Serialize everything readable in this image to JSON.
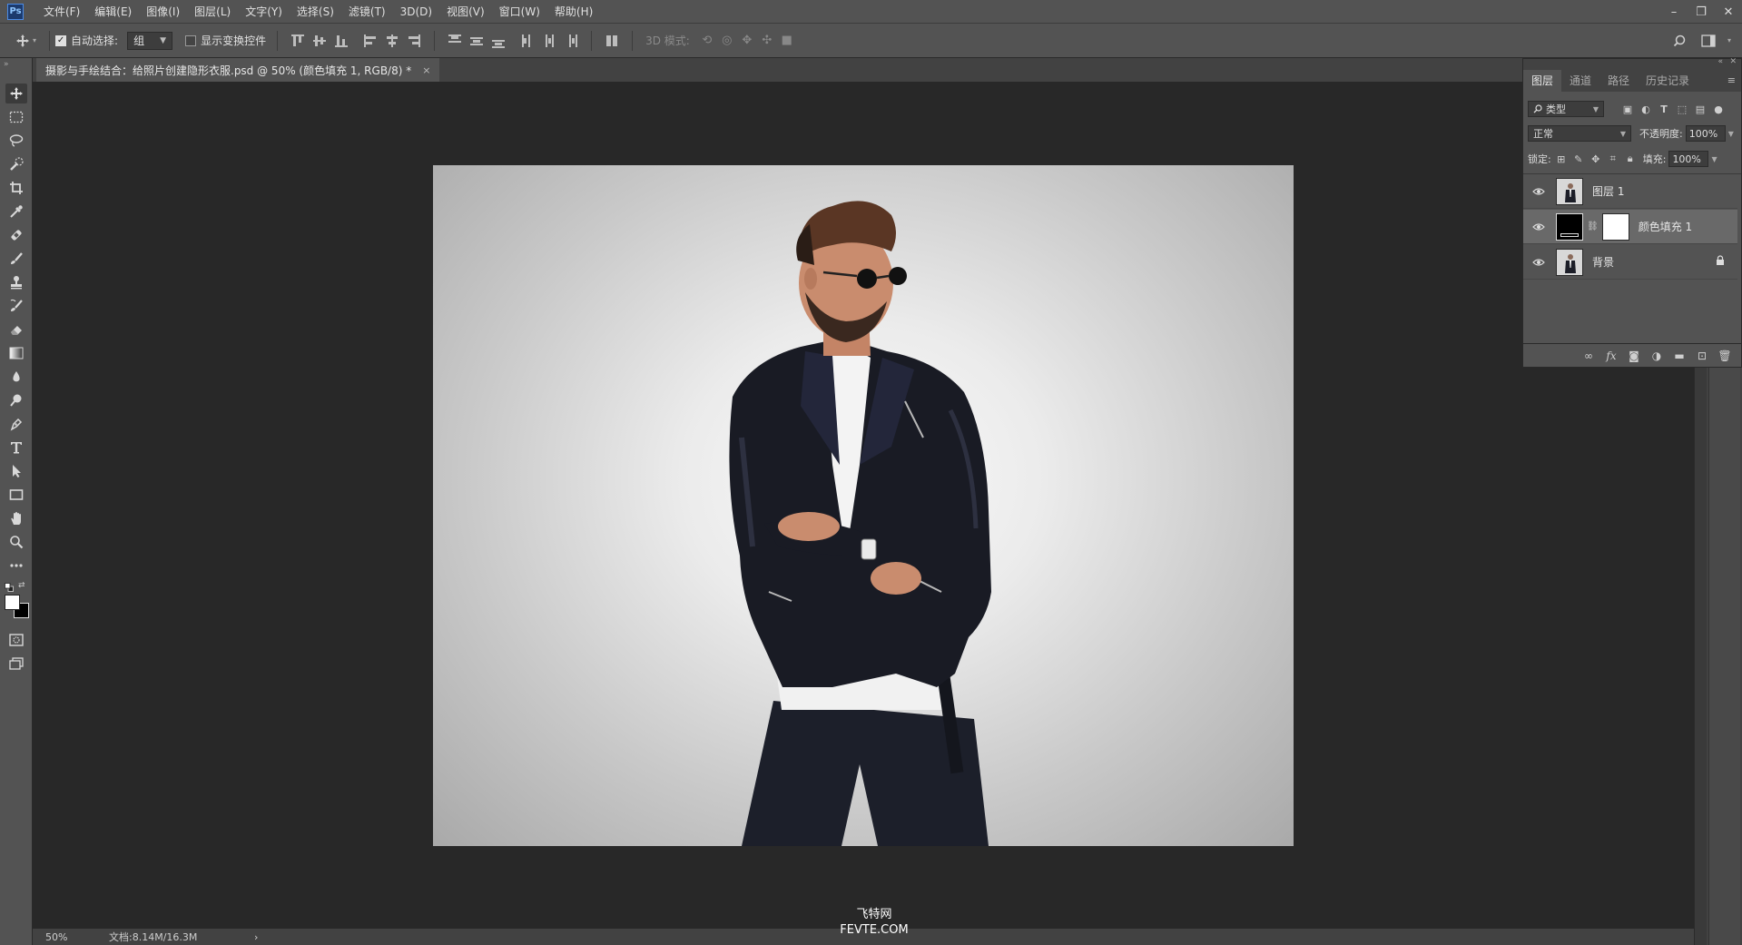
{
  "menubar": {
    "logo": "Ps",
    "items": [
      "文件(F)",
      "编辑(E)",
      "图像(I)",
      "图层(L)",
      "文字(Y)",
      "选择(S)",
      "滤镜(T)",
      "3D(D)",
      "视图(V)",
      "窗口(W)",
      "帮助(H)"
    ],
    "window_controls": [
      "–",
      "❐",
      "✕"
    ]
  },
  "options": {
    "auto_select_label": "自动选择:",
    "auto_select_checked": true,
    "auto_select_target": "组",
    "show_transform_label": "显示变换控件",
    "show_transform_checked": false,
    "mode_3d_label": "3D 模式:"
  },
  "document": {
    "tab_title": "摄影与手绘结合：给照片创建隐形衣服.psd @ 50% (颜色填充 1, RGB/8) *",
    "close_glyph": "×"
  },
  "status": {
    "zoom": "50%",
    "doc_info": "文档:8.14M/16.3M",
    "arrow": "›"
  },
  "layers_panel": {
    "tabs": [
      "图层",
      "通道",
      "路径",
      "历史记录"
    ],
    "active_tab": "图层",
    "filter_label": "类型",
    "blend_mode": "正常",
    "opacity_label": "不透明度:",
    "opacity_value": "100%",
    "lock_label": "锁定:",
    "fill_label": "填充:",
    "fill_value": "100%",
    "layers": [
      {
        "name": "图层 1",
        "visible": true,
        "selected": false,
        "locked": false
      },
      {
        "name": "颜色填充 1",
        "visible": true,
        "selected": true,
        "locked": false
      },
      {
        "name": "背景",
        "visible": true,
        "selected": false,
        "locked": true
      }
    ],
    "bottom_icons": [
      "link-icon",
      "fx-icon",
      "mask-icon",
      "adjustment-icon",
      "folder-icon",
      "new-layer-icon",
      "trash-icon"
    ],
    "fx_label": "fx"
  },
  "watermark": {
    "line1": "飞特网",
    "line2": "FEVTE.COM"
  },
  "colors": {
    "ui_panel": "#535353",
    "ui_dark": "#282828",
    "accent_logo": "#4b8be6"
  }
}
